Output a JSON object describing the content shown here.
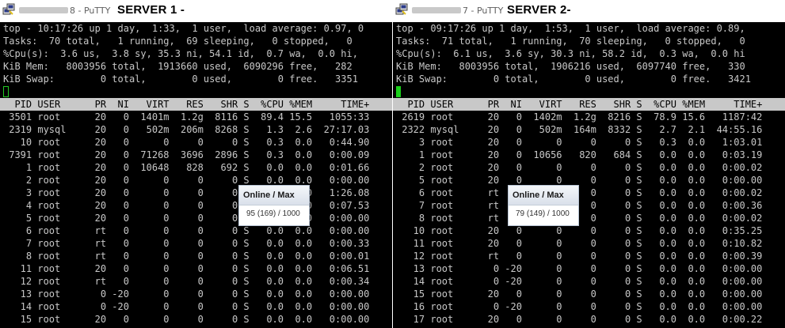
{
  "left": {
    "window_title": "8 - PuTTY",
    "server_label": "SERVER 1 -",
    "summary": [
      "top - 10:17:26 up 1 day,  1:33,  1 user,  load average: 0.97, 0",
      "Tasks:  70 total,   1 running,  69 sleeping,   0 stopped,   0",
      "%Cpu(s):  3.6 us,  3.8 sy, 35.3 ni, 54.1 id,  0.7 wa,  0.0 hi,",
      "KiB Mem:   8003956 total,  1913660 used,  6090296 free,   282",
      "KiB Swap:        0 total,        0 used,        0 free.   3351"
    ],
    "header": "  PID USER      PR  NI   VIRT   RES   SHR S  %CPU %MEM     TIME+",
    "processes": [
      " 3501 root      20   0  1401m  1.2g  8116 S  89.4 15.5   1055:33",
      " 2319 mysql     20   0   502m  206m  8268 S   1.3  2.6  27:17.03",
      "   10 root      20   0      0     0     0 S   0.3  0.0   0:44.90",
      " 7391 root      20   0  71268  3696  2896 S   0.3  0.0   0:00.09",
      "    1 root      20   0  10648   828   692 S   0.0  0.0   0:01.66",
      "    2 root      20   0      0     0     0 S   0.0  0.0   0:00.00",
      "    3 root      20   0      0     0     0 S   0.0  0.0   1:26.08",
      "    4 root      20   0      0     0     0 S   0.0  0.0   0:07.53",
      "    5 root      20   0      0     0     0 S   0.0  0.0   0:00.00",
      "    6 root      rt   0      0     0     0 S   0.0  0.0   0:00.00",
      "    7 root      rt   0      0     0     0 S   0.0  0.0   0:00.33",
      "    8 root      rt   0      0     0     0 S   0.0  0.0   0:00.01",
      "   11 root      20   0      0     0     0 S   0.0  0.0   0:06.51",
      "   12 root      rt   0      0     0     0 S   0.0  0.0   0:00.34",
      "   13 root       0 -20      0     0     0 S   0.0  0.0   0:00.00",
      "   14 root       0 -20      0     0     0 S   0.0  0.0   0:00.00",
      "   15 root      20   0      0     0     0 S   0.0  0.0   0:00.00"
    ],
    "popup": {
      "title": "Online / Max",
      "value": "95 (169) / 1000"
    }
  },
  "right": {
    "window_title": "7 - PuTTY",
    "server_label": "SERVER 2-",
    "summary": [
      "top - 09:17:26 up 1 day,  1:53,  1 user,  load average: 0.89,",
      "Tasks:  71 total,   1 running,  70 sleeping,   0 stopped,   0",
      "%Cpu(s):  6.1 us,  3.6 sy, 30.3 ni, 58.2 id,  0.3 wa,  0.0 hi",
      "KiB Mem:   8003956 total,  1906216 used,  6097740 free,   330",
      "KiB Swap:        0 total,        0 used,        0 free.   3421"
    ],
    "header": "  PID USER      PR  NI   VIRT   RES   SHR S  %CPU %MEM     TIME+",
    "processes": [
      " 2619 root      20   0  1402m  1.2g  8216 S  78.9 15.6   1187:42",
      " 2322 mysql     20   0   502m  164m  8332 S   2.7  2.1  44:55.16",
      "    3 root      20   0      0     0     0 S   0.3  0.0   1:03.01",
      "    1 root      20   0  10656   820   684 S   0.0  0.0   0:03.19",
      "    2 root      20   0      0     0     0 S   0.0  0.0   0:00.02",
      "    5 root      20   0      0     0     0 S   0.0  0.0   0:00.00",
      "    6 root      rt   0      0     0     0 S   0.0  0.0   0:00.02",
      "    7 root      rt   0      0     0     0 S   0.0  0.0   0:00.36",
      "    8 root      rt   0      0     0     0 S   0.0  0.0   0:00.02",
      "   10 root      20   0      0     0     0 S   0.0  0.0   0:35.25",
      "   11 root      20   0      0     0     0 S   0.0  0.0   0:10.82",
      "   12 root      rt   0      0     0     0 S   0.0  0.0   0:00.39",
      "   13 root       0 -20      0     0     0 S   0.0  0.0   0:00.00",
      "   14 root       0 -20      0     0     0 S   0.0  0.0   0:00.00",
      "   15 root      20   0      0     0     0 S   0.0  0.0   0:00.00",
      "   16 root       0 -20      0     0     0 S   0.0  0.0   0:00.00",
      "   17 root      20   0      0     0     0 S   0.0  0.0   0:00.22"
    ],
    "popup": {
      "title": "Online / Max",
      "value": "79 (149) / 1000"
    }
  }
}
